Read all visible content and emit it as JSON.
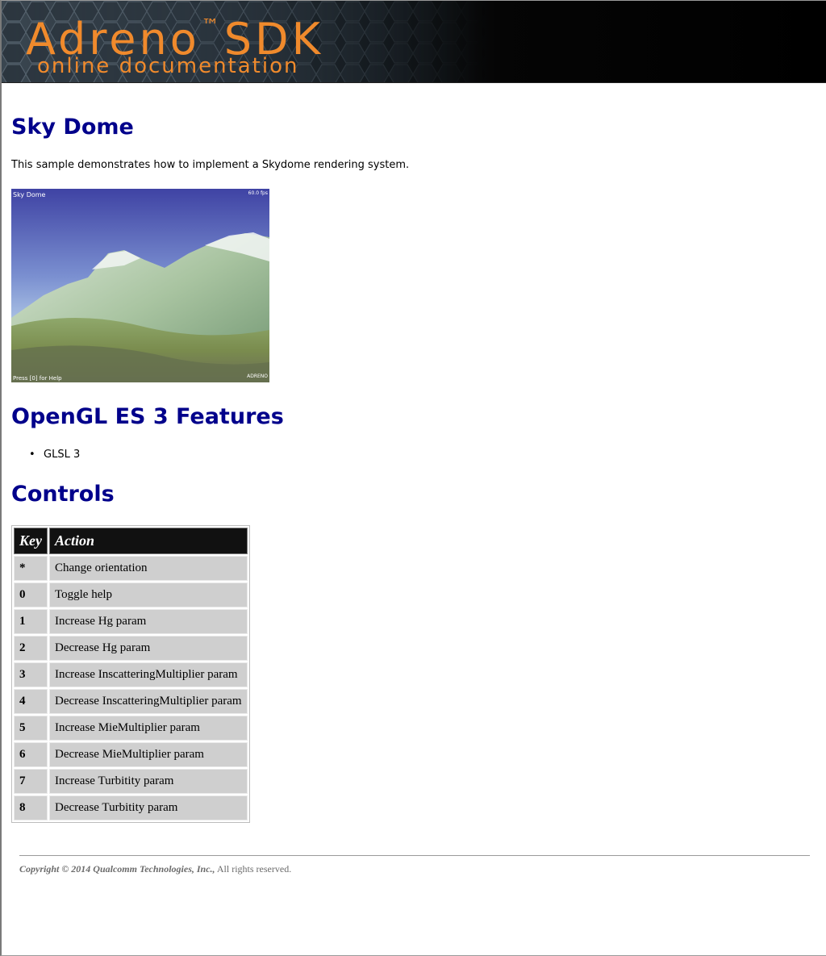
{
  "banner": {
    "title": "Adreno",
    "trademark": "™",
    "product": "SDK",
    "subtitle": "online documentation"
  },
  "page": {
    "title": "Sky Dome",
    "description": "This sample demonstrates how to implement a Skydome rendering system."
  },
  "screenshot": {
    "overlay_title": "Sky Dome",
    "overlay_fps": "60.0 fps",
    "overlay_help": "Press [0] for Help",
    "overlay_logo": "ADRENO"
  },
  "features": {
    "heading": "OpenGL ES 3 Features",
    "items": [
      "GLSL 3"
    ]
  },
  "controls": {
    "heading": "Controls",
    "columns": [
      "Key",
      "Action"
    ],
    "rows": [
      {
        "key": "*",
        "action": "Change orientation"
      },
      {
        "key": "0",
        "action": "Toggle help"
      },
      {
        "key": "1",
        "action": "Increase Hg param"
      },
      {
        "key": "2",
        "action": "Decrease Hg param"
      },
      {
        "key": "3",
        "action": "Increase InscatteringMultiplier param"
      },
      {
        "key": "4",
        "action": "Decrease InscatteringMultiplier param"
      },
      {
        "key": "5",
        "action": "Increase MieMultiplier param"
      },
      {
        "key": "6",
        "action": "Decrease MieMultiplier param"
      },
      {
        "key": "7",
        "action": "Increase Turbitity param"
      },
      {
        "key": "8",
        "action": "Decrease Turbitity param"
      }
    ]
  },
  "footer": {
    "company": "Copyright © 2014 Qualcomm Technologies, Inc.,",
    "rights": "All rights reserved."
  },
  "colors": {
    "heading": "#00008b",
    "banner_text": "#f08a2c",
    "table_header_bg": "#111111",
    "table_cell_bg": "#cfcfcf"
  }
}
